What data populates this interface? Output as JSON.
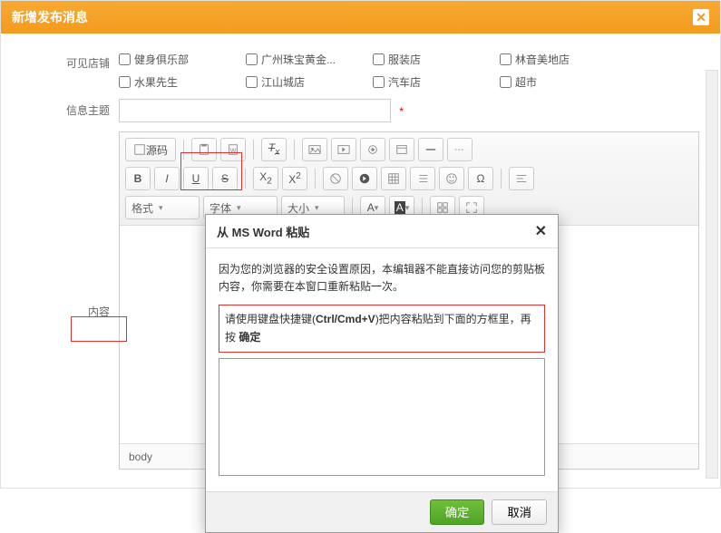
{
  "header": {
    "title": "新增发布消息"
  },
  "labels": {
    "visibleStores": "可见店铺",
    "subject": "信息主题",
    "content": "内容"
  },
  "stores": [
    "健身俱乐部",
    "广州珠宝黄金...",
    "服装店",
    "林音美地店",
    "水果先生",
    "江山城店",
    "汽车店",
    "超市"
  ],
  "required": "*",
  "toolbar": {
    "source": "源码",
    "format": "格式",
    "font": "字体",
    "size": "大小"
  },
  "editorFooter": "body",
  "dialog": {
    "title": "从 MS Word 粘贴",
    "msg": "因为您的浏览器的安全设置原因，本编辑器不能直接访问您的剪贴板内容，你需要在本窗口重新粘贴一次。",
    "hint_pre": "请使用键盘快捷键(",
    "hint_key": "Ctrl/Cmd+V",
    "hint_mid": ")把内容粘贴到下面的方框里，再按 ",
    "hint_ok": "确定",
    "ok": "确定",
    "cancel": "取消"
  }
}
